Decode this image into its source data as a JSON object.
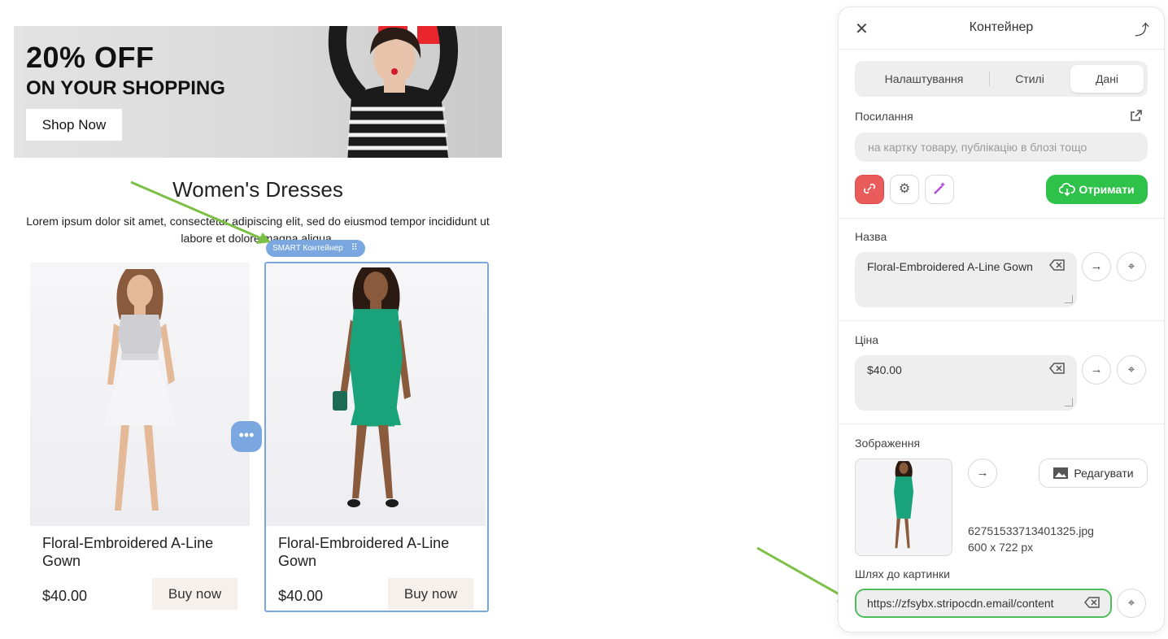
{
  "banner": {
    "title": "20% OFF",
    "subtitle": "ON YOUR SHOPPING",
    "button": "Shop Now"
  },
  "section": {
    "title": "Women's Dresses",
    "description": "Lorem ipsum dolor sit amet, consectetur adipiscing elit, sed do eiusmod tempor incididunt ut labore et dolore magna aliqua."
  },
  "products": [
    {
      "name": "Floral-Embroidered A-Line Gown",
      "price": "$40.00",
      "button": "Buy now",
      "dress_color": "#e9e9ec"
    },
    {
      "name": "Floral-Embroidered A-Line Gown",
      "price": "$40.00",
      "button": "Buy now",
      "dress_color": "#1aa37a"
    }
  ],
  "editor": {
    "smart_label": "SMART Контейнер",
    "more_icon": "more-horizontal-icon"
  },
  "panel": {
    "title": "Контейнер",
    "tabs": [
      {
        "label": "Налаштування",
        "active": false
      },
      {
        "label": "Стилі",
        "active": false
      },
      {
        "label": "Дані",
        "active": true
      }
    ],
    "link": {
      "label": "Посилання",
      "placeholder": "на картку товару, публікацію в блозі тощо"
    },
    "get_button": "Отримати",
    "name": {
      "label": "Назва",
      "value": "Floral-Embroidered A-Line Gown"
    },
    "price": {
      "label": "Ціна",
      "value": "$40.00"
    },
    "image": {
      "label": "Зображення",
      "edit_button": "Редагувати",
      "file_name": "62751533713401325.jpg",
      "file_size": "600 x 722 px"
    },
    "path": {
      "label": "Шлях до картинки",
      "value": "https://zfsybx.stripocdn.email/content"
    }
  },
  "colors": {
    "accent_blue": "#7aa7e0",
    "green": "#2fc24a",
    "red": "#ea5b5b",
    "arrow_green": "#7cbf45"
  }
}
